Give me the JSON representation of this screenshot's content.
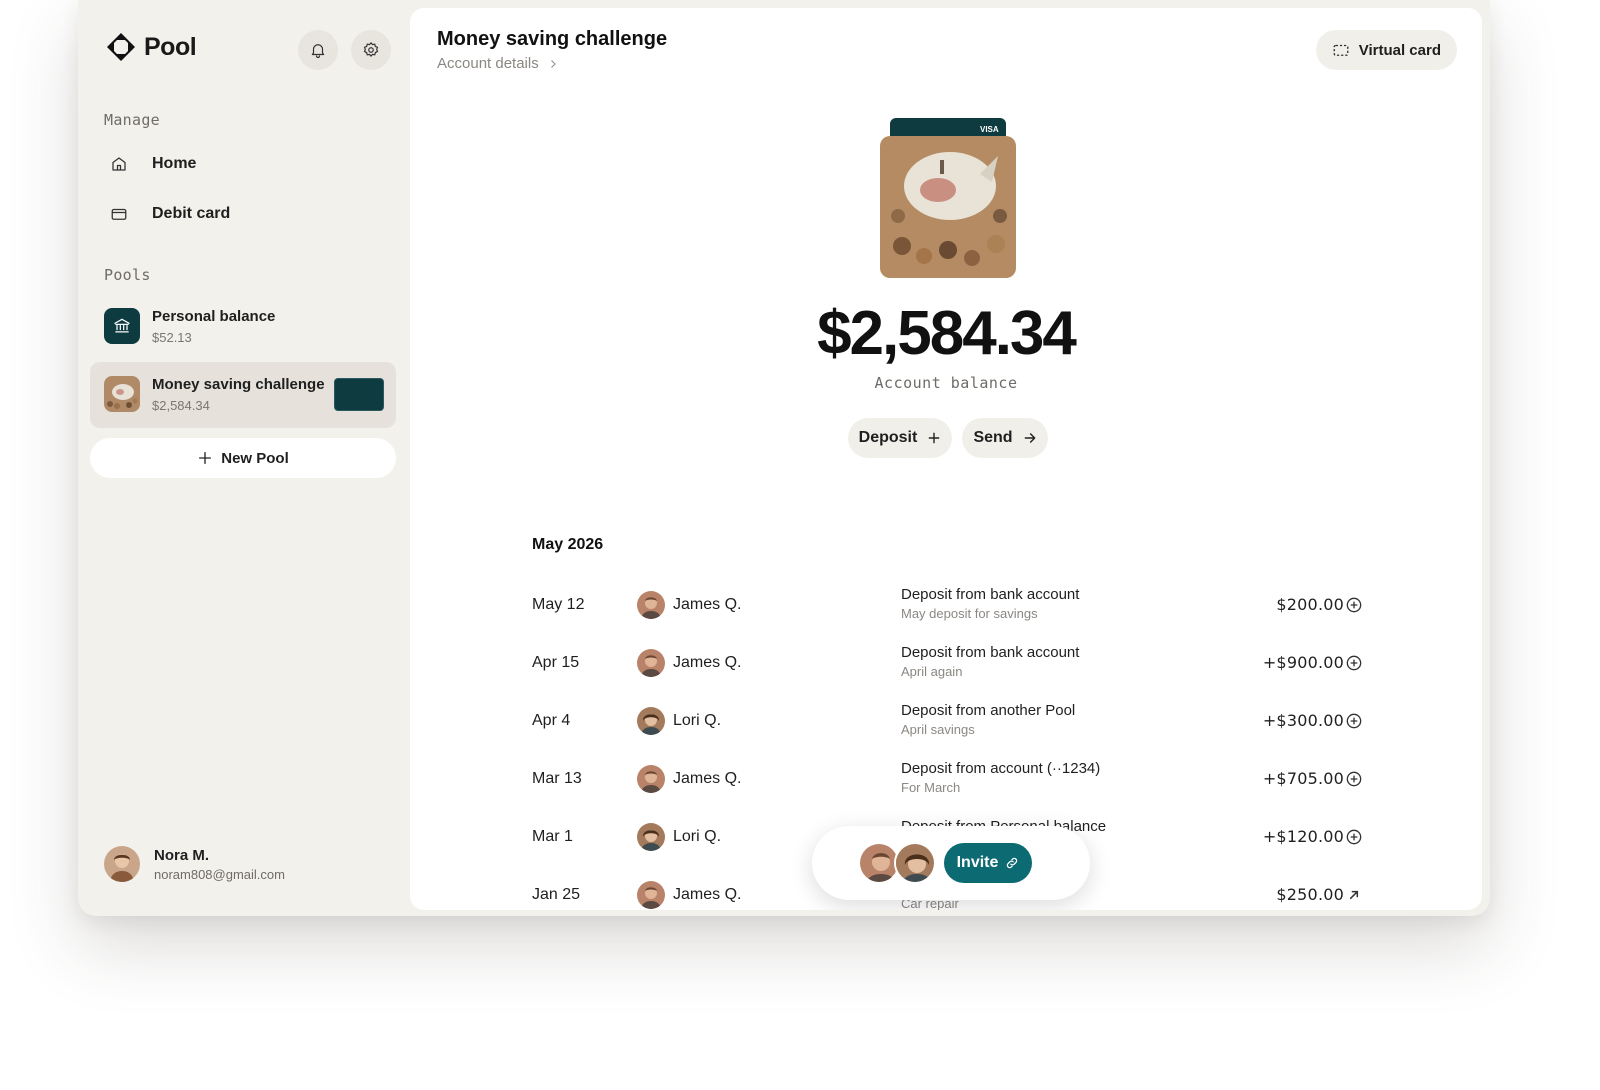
{
  "app": {
    "name": "Pool"
  },
  "sidebar": {
    "manage_label": "Manage",
    "nav": [
      {
        "label": "Home",
        "icon": "home-icon"
      },
      {
        "label": "Debit card",
        "icon": "card-icon"
      }
    ],
    "pools_label": "Pools",
    "pools": [
      {
        "title": "Personal balance",
        "amount": "$52.13",
        "icon": "bank-icon"
      },
      {
        "title": "Money saving challenge",
        "amount": "$2,584.34",
        "active": true
      }
    ],
    "new_pool_label": "New Pool",
    "user": {
      "name": "Nora M.",
      "email": "noram808@gmail.com"
    }
  },
  "main": {
    "title": "Money saving challenge",
    "breadcrumb": "Account details",
    "virtual_card_label": "Virtual card",
    "card_brand": "VISA",
    "balance": "$2,584.34",
    "balance_label": "Account balance",
    "deposit_label": "Deposit",
    "send_label": "Send",
    "month": "May 2026",
    "transactions": [
      {
        "date": "May 12",
        "person": "James Q.",
        "desc": "Deposit from bank account",
        "note": "May deposit for savings",
        "amount": "$200.00",
        "action": "plus-circle-icon"
      },
      {
        "date": "Apr 15",
        "person": "James Q.",
        "desc": "Deposit from bank account",
        "note": "April again",
        "amount": "+$900.00",
        "action": "plus-circle-icon"
      },
      {
        "date": "Apr 4",
        "person": "Lori Q.",
        "desc": "Deposit from another Pool",
        "note": "April savings",
        "amount": "+$300.00",
        "action": "plus-circle-icon"
      },
      {
        "date": "Mar 13",
        "person": "James Q.",
        "desc": "Deposit from account (··1234)",
        "note": "For March",
        "amount": "+$705.00",
        "action": "plus-circle-icon"
      },
      {
        "date": "Mar 1",
        "person": "Lori Q.",
        "desc": "Deposit from Personal balance",
        "note": "",
        "amount": "+$120.00",
        "action": "plus-circle-icon"
      },
      {
        "date": "Jan 25",
        "person": "James Q.",
        "desc": "",
        "note": "Car repair",
        "amount": "$250.00",
        "action": "arrow-up-right-icon"
      }
    ],
    "invite_label": "Invite"
  },
  "colors": {
    "accent": "#0c6b72",
    "card": "#0d3b40",
    "sidebar_bg": "#f3f1ec"
  }
}
